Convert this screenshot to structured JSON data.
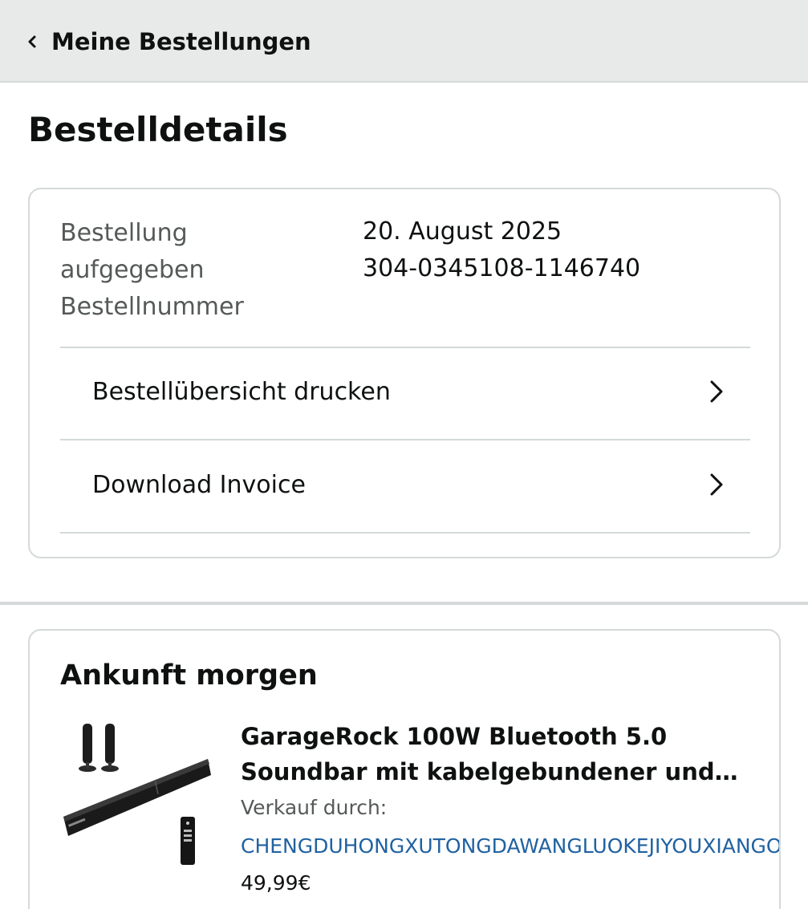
{
  "header": {
    "back_label": "Meine Bestellungen"
  },
  "page": {
    "title": "Bestelldetails"
  },
  "order_info": {
    "labels": [
      "Bestellung",
      "aufgegeben",
      "Bestellnummer"
    ],
    "date": "20. August 2025",
    "order_number": "304-0345108-1146740"
  },
  "actions": [
    {
      "label": "Bestellübersicht drucken"
    },
    {
      "label": "Download Invoice"
    }
  ],
  "shipment": {
    "arrival": "Ankunft morgen",
    "product": {
      "title_line1": "GarageRock 100W Bluetooth 5.0",
      "title_line2": "Soundbar mit kabelgebundener und…",
      "sold_by_label": "Verkauf durch:",
      "seller": "CHENGDUHONGXUTONGDAWANGLUOKEJIYOUXIANGONGSI",
      "price": "49,99€"
    }
  },
  "colors": {
    "link": "#2162a1",
    "muted": "#565959",
    "border": "#d5d9d9",
    "header_bg": "#e8eaea"
  }
}
